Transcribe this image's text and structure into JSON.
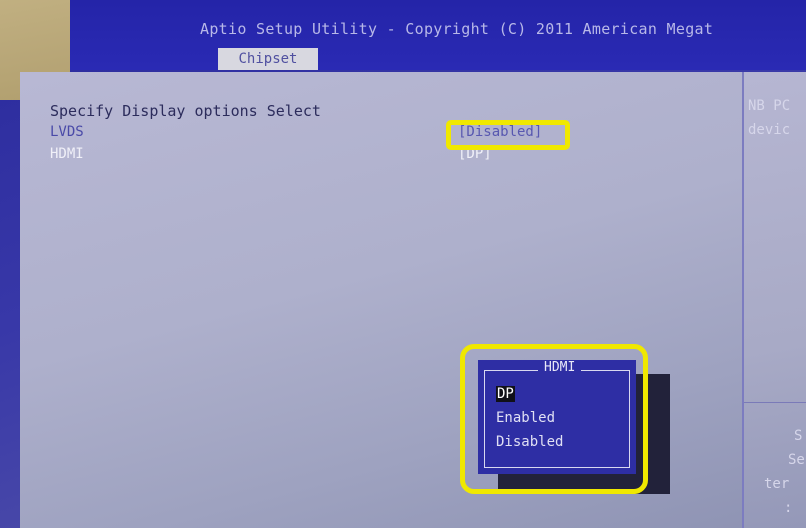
{
  "header": {
    "title": "Aptio Setup Utility - Copyright (C) 2011 American Megat",
    "tab": "Chipset"
  },
  "main": {
    "description": "Specify Display options Select",
    "rows": [
      {
        "label": "LVDS",
        "value": "[Disabled]"
      },
      {
        "label": "HDMI",
        "value": "[DP]"
      }
    ]
  },
  "help": {
    "top_lines": [
      "NB PC",
      "devic"
    ],
    "bottom_lines": [
      "S",
      "Se",
      "ter",
      ":"
    ]
  },
  "popup": {
    "title": "HDMI",
    "options": [
      "DP",
      "Enabled",
      "Disabled"
    ],
    "selected": "DP"
  },
  "colors": {
    "highlight": "#f0e800",
    "bios_blue": "#2e2ea4",
    "panel_gray": "#b0b2ce"
  }
}
